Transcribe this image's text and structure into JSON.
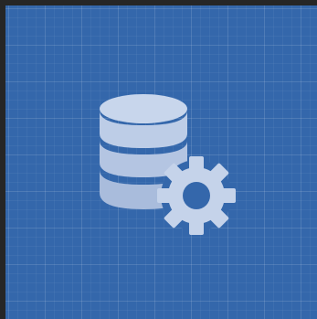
{
  "icon": {
    "name": "database-settings-icon",
    "parts": [
      "database-icon",
      "gear-icon"
    ]
  },
  "colors": {
    "tile_background": "#3467ab",
    "icon_fill": "#c5d3ea",
    "icon_fill_shade": "#a9bcdc",
    "frame": "#262626"
  }
}
